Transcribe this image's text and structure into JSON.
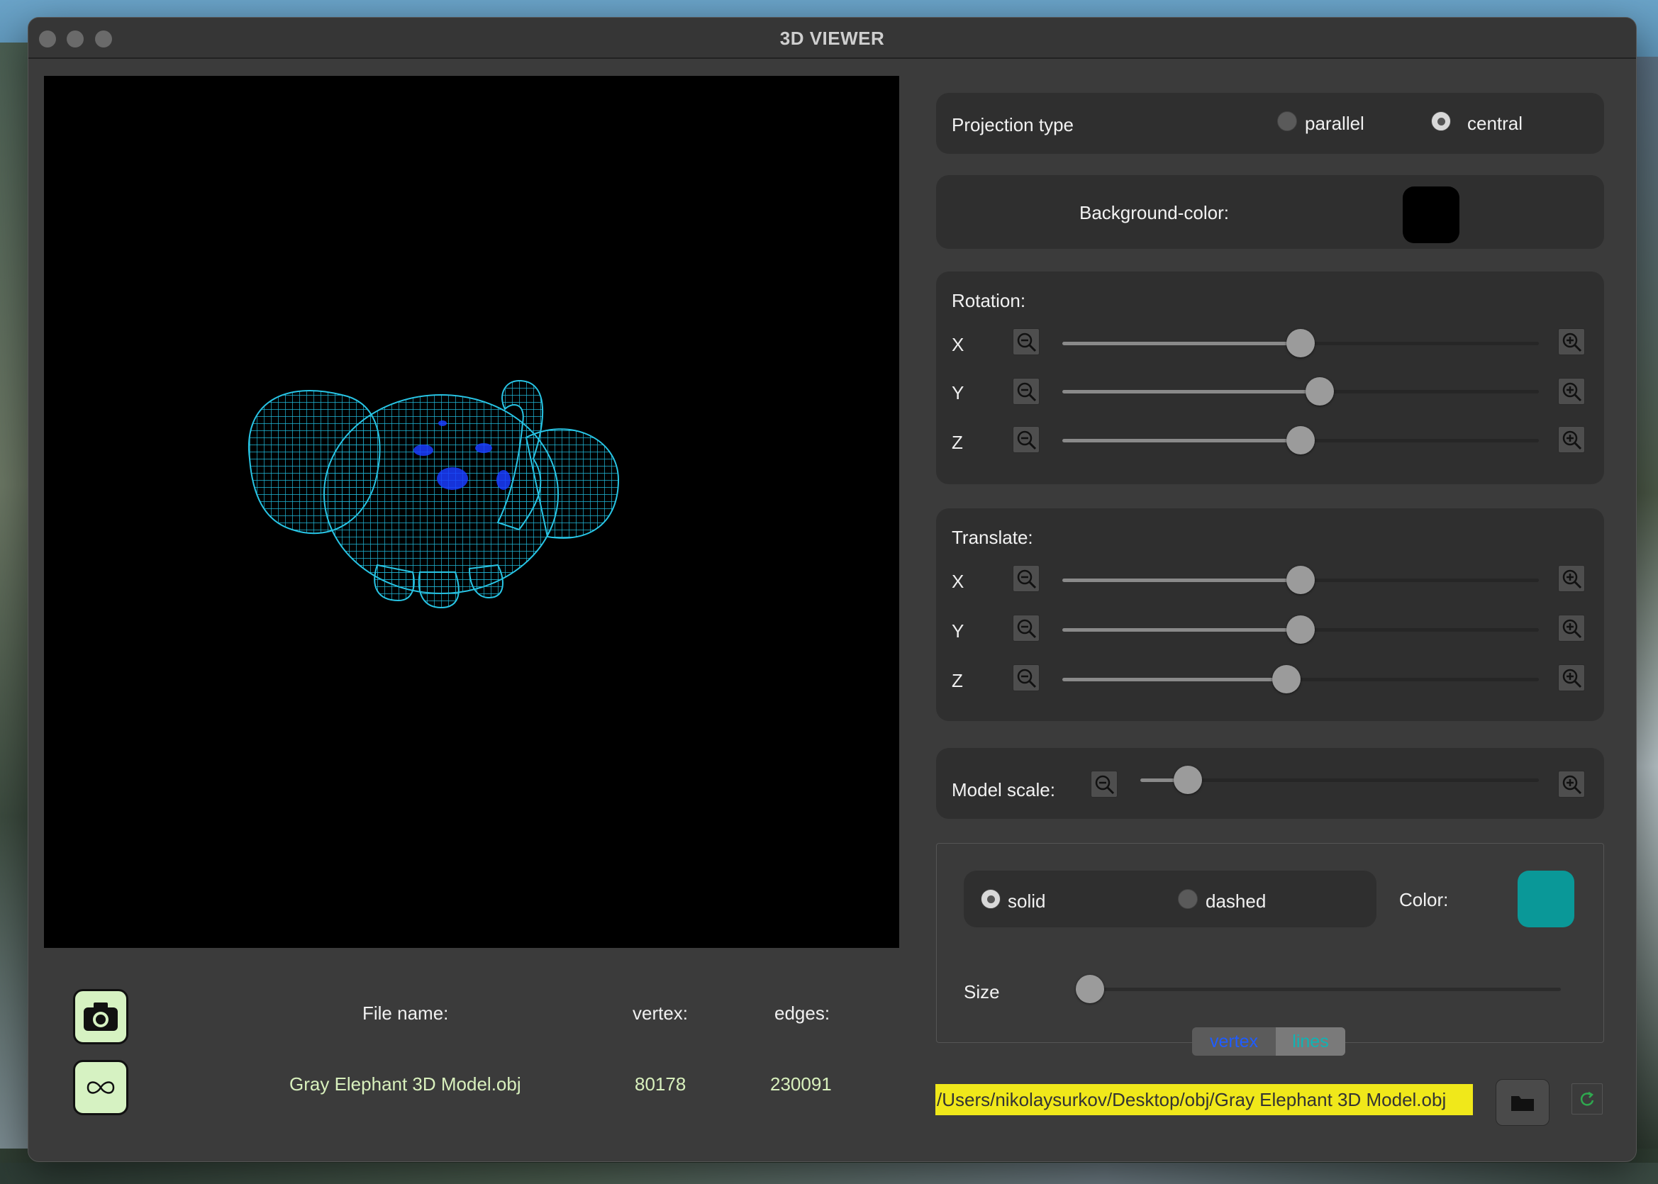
{
  "window": {
    "title": "3D VIEWER"
  },
  "file_info": {
    "file_name_label": "File name:",
    "vertex_label": "vertex:",
    "edges_label": "edges:",
    "file_name": "Gray Elephant 3D Model.obj",
    "vertex_count": "80178",
    "edges_count": "230091"
  },
  "projection": {
    "label": "Projection type",
    "options": [
      "parallel",
      "central"
    ],
    "selected": "central"
  },
  "background": {
    "label": "Background-color:",
    "color": "#000000"
  },
  "rotation": {
    "label": "Rotation:",
    "axes": [
      {
        "name": "X",
        "value": 0.5
      },
      {
        "name": "Y",
        "value": 0.54
      },
      {
        "name": "Z",
        "value": 0.5
      }
    ]
  },
  "translate": {
    "label": "Translate:",
    "axes": [
      {
        "name": "X",
        "value": 0.5
      },
      {
        "name": "Y",
        "value": 0.5
      },
      {
        "name": "Z",
        "value": 0.47
      }
    ]
  },
  "model_scale": {
    "label": "Model scale:",
    "value": 0.12
  },
  "style": {
    "line_type_options": [
      "solid",
      "dashed"
    ],
    "selected": "solid",
    "color_label": "Color:",
    "color": "#0a9898",
    "size_label": "Size",
    "size_value": 0.0
  },
  "mode_tabs": {
    "items": [
      "vertex",
      "lines"
    ],
    "active": "lines"
  },
  "path": "/Users/nikolaysurkov/Desktop/obj/Gray Elephant 3D Model.obj",
  "icons": {
    "screenshot": "camera-icon",
    "gif": "infinity-icon",
    "open": "folder-icon",
    "reload": "refresh-icon",
    "zoom_out": "zoom-out-icon",
    "zoom_in": "zoom-in-icon"
  }
}
